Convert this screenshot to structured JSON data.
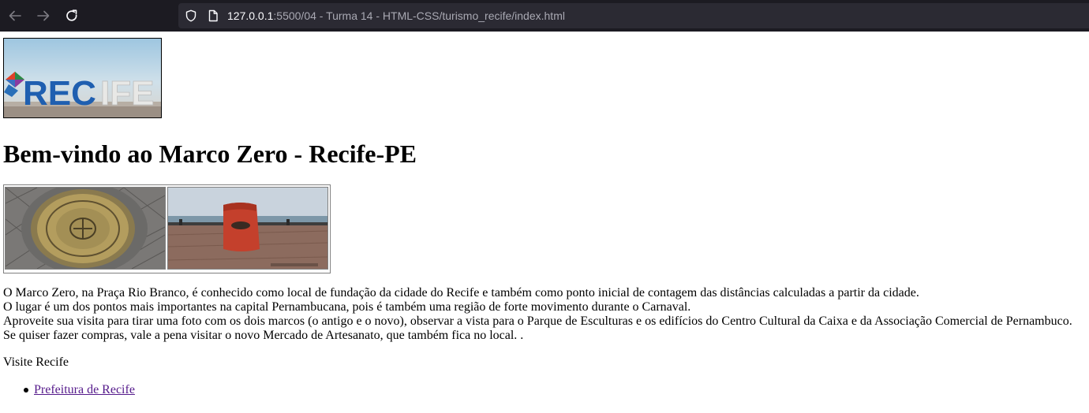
{
  "browser": {
    "url_host": "127.0.0.1",
    "url_rest": ":5500/04 - Turma 14 - HTML-CSS/turismo_recife/index.html",
    "icons": {
      "back": "arrow-left-icon",
      "forward": "arrow-right-icon",
      "reload": "reload-icon",
      "shield": "shield-icon",
      "page": "page-icon"
    }
  },
  "page": {
    "logo_text": "RECIFE",
    "heading": "Bem-vindo ao Marco Zero - Recife-PE",
    "gallery": [
      {
        "name": "marco-zero-compass-image"
      },
      {
        "name": "marco-zero-new-marker-image"
      }
    ],
    "paragraph_lines": [
      "O Marco Zero, na Praça Rio Branco, é conhecido como local de fundação da cidade do Recife e também como ponto inicial de contagem das distâncias calculadas a partir da cidade.",
      "O lugar é um dos pontos mais importantes na capital Pernambucana, pois é também uma região de forte movimento durante o Carnaval.",
      "Aproveite sua visita para tirar uma foto com os dois marcos (o antigo e o novo), observar a vista para o Parque de Esculturas e os edifícios do Centro Cultural da Caixa e da Associação Comercial de Pernambuco.",
      "Se quiser fazer compras, vale a pena visitar o novo Mercado de Artesanato, que também fica no local. ."
    ],
    "visit_label": "Visite Recife",
    "links": [
      {
        "label": "Prefeitura de Recife"
      }
    ]
  },
  "colors": {
    "chrome_bg": "#1c1b22",
    "urlbar_bg": "#2b2a33",
    "link_visited": "#551a8b"
  }
}
